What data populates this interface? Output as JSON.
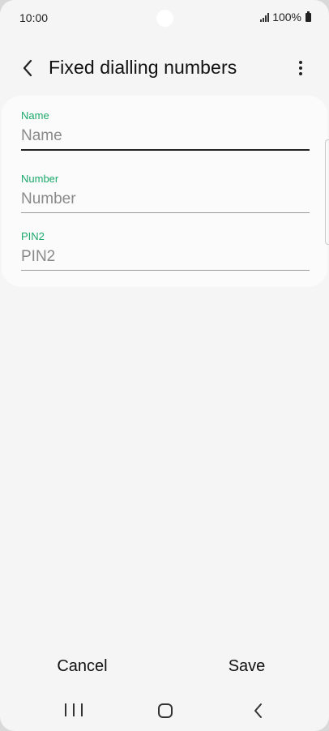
{
  "status_bar": {
    "time": "10:00",
    "battery": "100%",
    "icons": [
      "signal-icon",
      "battery-icon"
    ]
  },
  "header": {
    "title": "Fixed dialling numbers",
    "back_icon": "back-arrow-icon",
    "more_icon": "more-options-icon"
  },
  "form": {
    "fields": [
      {
        "label": "Name",
        "value": "",
        "placeholder": "Name"
      },
      {
        "label": "Number",
        "value": "",
        "placeholder": "Number"
      },
      {
        "label": "PIN2",
        "value": "",
        "placeholder": "PIN2"
      }
    ]
  },
  "actions": {
    "cancel_label": "Cancel",
    "save_label": "Save"
  },
  "navigation": {
    "icons": [
      "recents-icon",
      "home-icon",
      "back-icon"
    ]
  },
  "colors": {
    "accent": "#1ba86b",
    "background": "#f5f5f5",
    "card": "#fbfbfb",
    "text": "#111111"
  }
}
